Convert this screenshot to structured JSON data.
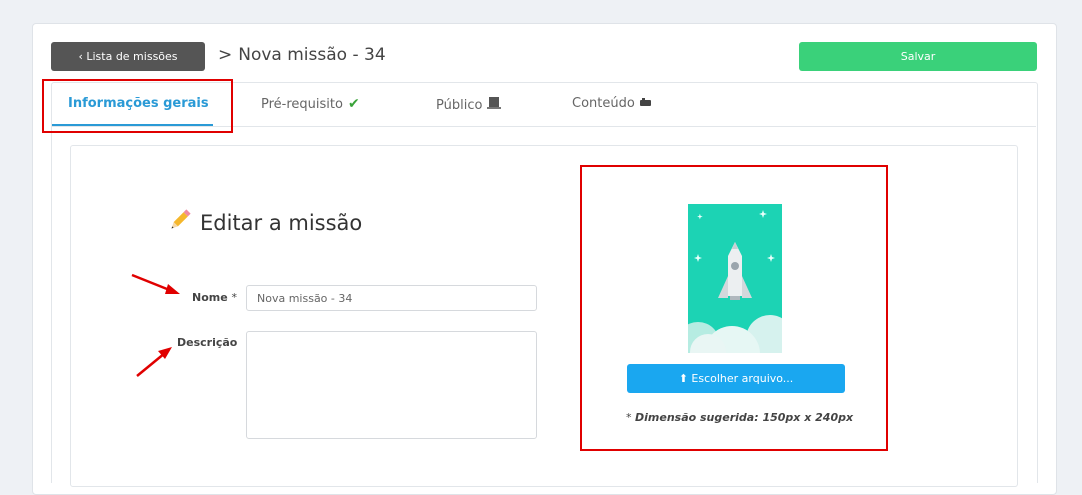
{
  "header": {
    "back_label": "‹ Lista de missões",
    "crumb_separator": ">",
    "crumb_title": "Nova missão - 34",
    "save_label": "Salvar"
  },
  "tabs": [
    {
      "label": "Informações gerais",
      "icon": ""
    },
    {
      "label": "Pré-requisito",
      "icon": "✔"
    },
    {
      "label": "Público",
      "icon": "▆"
    },
    {
      "label": "Conteúdo",
      "icon": "■"
    }
  ],
  "form": {
    "title": "Editar a missão",
    "name_label": "Nome",
    "required_mark": "*",
    "name_value": "Nova missão - 34",
    "description_label": "Descrição",
    "description_value": ""
  },
  "image_panel": {
    "choose_label": "⬆ Escolher arquivo...",
    "hint_prefix": "* ",
    "hint_text": "Dimensão sugerida: 150px x 240px"
  },
  "colors": {
    "accent_tab": "#2a9ad6",
    "save": "#3ad17a",
    "choose": "#1aa7f0",
    "annotation": "#e00000",
    "preview_bg": "#1cd3b4"
  }
}
